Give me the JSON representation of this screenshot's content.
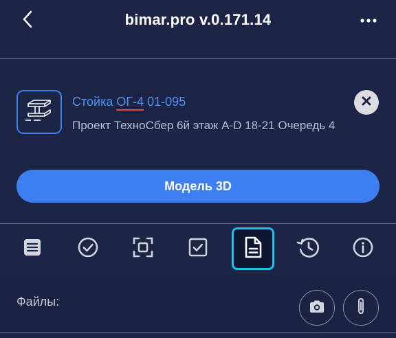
{
  "header": {
    "title": "bimar.pro v.0.171.14",
    "back_icon": "chevron-left-icon",
    "more_icon": "ellipsis-icon"
  },
  "card": {
    "icon": "steel-beam-icon",
    "title_prefix": "Стойка ",
    "title_mark": "ОГ-4",
    "title_suffix": " 01-095",
    "subtitle": "Проект ТехноСбер 6й этаж A-D 18-21 Очередь 4",
    "close_icon": "close-icon"
  },
  "primary_button": {
    "label": "Модель 3D"
  },
  "tabs": [
    {
      "icon": "list-document-icon",
      "active": false
    },
    {
      "icon": "check-circle-icon",
      "active": false
    },
    {
      "icon": "scan-frame-icon",
      "active": false
    },
    {
      "icon": "checkbox-icon",
      "active": false
    },
    {
      "icon": "file-text-icon",
      "active": true
    },
    {
      "icon": "history-icon",
      "active": false
    },
    {
      "icon": "info-icon",
      "active": false
    }
  ],
  "files": {
    "label": "Файлы:",
    "camera_icon": "camera-icon",
    "attach_icon": "paperclip-icon"
  },
  "colors": {
    "background": "#1d2547",
    "accent": "#3d7ef0",
    "link": "#4f8ff0",
    "active_tab_border": "#17c1f0",
    "underline_mark": "#e0474f"
  }
}
